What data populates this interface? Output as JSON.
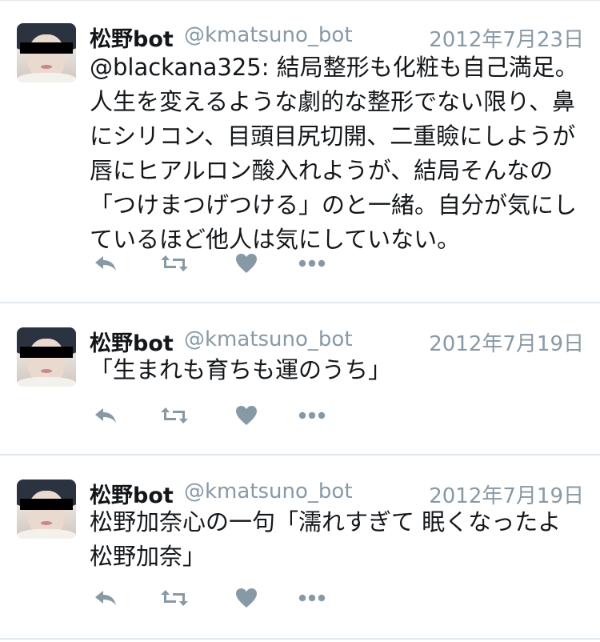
{
  "tweets": [
    {
      "name": "松野bot",
      "handle": "@kmatsuno_bot",
      "date": "2012年7月23日",
      "text": "@blackana325: 結局整形も化粧も自己満足。人生を変えるような劇的な整形でない限り、鼻にシリコン、目頭目尻切開、二重瞼にしようが唇にヒアルロン酸入れようが、結局そんなの「つけまつげつける」のと一緒。自分が気にしているほど他人は気にしていない。"
    },
    {
      "name": "松野bot",
      "handle": "@kmatsuno_bot",
      "date": "2012年7月19日",
      "text": "「生まれも育ちも運のうち」"
    },
    {
      "name": "松野bot",
      "handle": "@kmatsuno_bot",
      "date": "2012年7月19日",
      "text": "松野加奈心の一句「濡れすぎて 眠くなったよ 松野加奈」"
    }
  ],
  "icons": {
    "reply": "reply-icon",
    "retweet": "retweet-icon",
    "like": "heart-icon",
    "more": "more-icon"
  },
  "colors": {
    "icon": "#8899a6",
    "meta_text": "#8899a6",
    "divider": "#e1e8ed"
  }
}
